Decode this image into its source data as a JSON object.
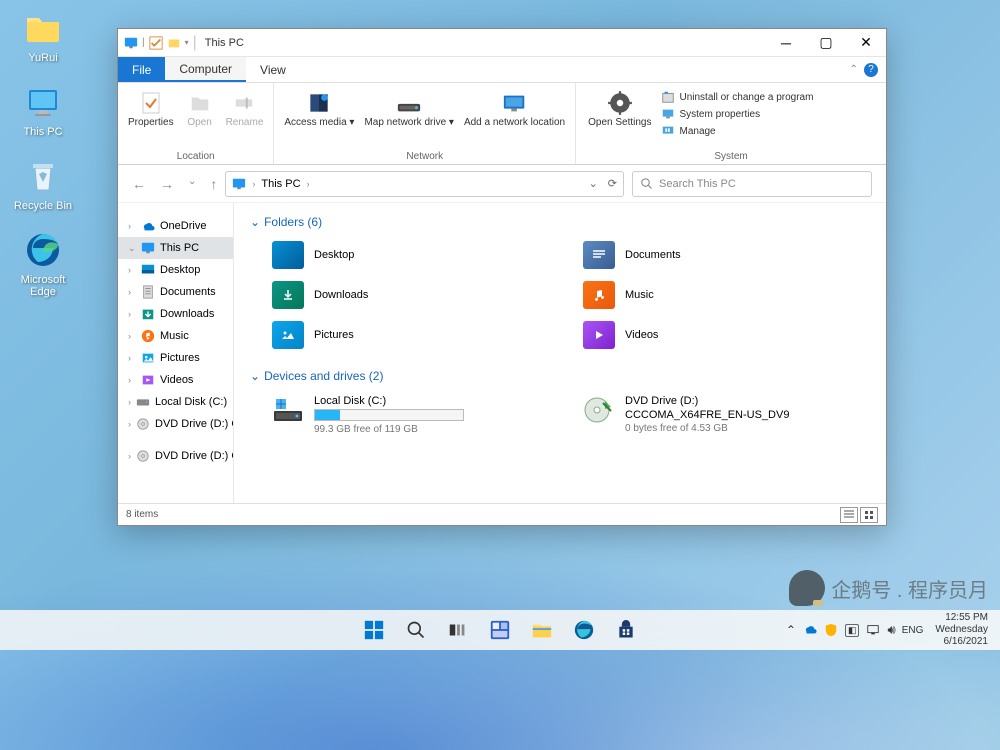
{
  "desktop_icons": [
    {
      "name": "folder-yurui",
      "label": "YuRui"
    },
    {
      "name": "this-pc-desktop",
      "label": "This PC"
    },
    {
      "name": "recycle-bin",
      "label": "Recycle Bin"
    },
    {
      "name": "edge",
      "label": "Microsoft Edge"
    }
  ],
  "titlebar": {
    "title": "This PC"
  },
  "menubar": {
    "file": "File",
    "computer": "Computer",
    "view": "View"
  },
  "ribbon": {
    "location": {
      "properties": "Properties",
      "open": "Open",
      "rename": "Rename",
      "group": "Location"
    },
    "network": {
      "access": "Access media ▾",
      "map": "Map network drive ▾",
      "add": "Add a network location",
      "group": "Network"
    },
    "system": {
      "open_settings": "Open Settings",
      "uninstall": "Uninstall or change a program",
      "properties": "System properties",
      "manage": "Manage",
      "group": "System"
    }
  },
  "address": {
    "location": "This PC"
  },
  "search": {
    "placeholder": "Search This PC"
  },
  "sidebar": [
    {
      "label": "OneDrive",
      "chev": "›",
      "icon": "cloud"
    },
    {
      "label": "This PC",
      "chev": "⌄",
      "icon": "monitor",
      "selected": true
    },
    {
      "label": "Desktop",
      "chev": "›",
      "icon": "desktop"
    },
    {
      "label": "Documents",
      "chev": "›",
      "icon": "documents"
    },
    {
      "label": "Downloads",
      "chev": "›",
      "icon": "downloads"
    },
    {
      "label": "Music",
      "chev": "›",
      "icon": "music"
    },
    {
      "label": "Pictures",
      "chev": "›",
      "icon": "pictures"
    },
    {
      "label": "Videos",
      "chev": "›",
      "icon": "videos"
    },
    {
      "label": "Local Disk (C:)",
      "chev": "›",
      "icon": "disk"
    },
    {
      "label": "DVD Drive (D:) C",
      "chev": "›",
      "icon": "dvd"
    },
    {
      "label": "DVD Drive (D:) CC",
      "chev": "›",
      "icon": "dvd",
      "gap_before": true
    }
  ],
  "content": {
    "folders_header": "Folders (6)",
    "folders": [
      {
        "label": "Desktop",
        "color1": "#0891d1",
        "color2": "#005c9c"
      },
      {
        "label": "Documents",
        "color1": "#5b8bc4",
        "color2": "#3a5d8f"
      },
      {
        "label": "Downloads",
        "color1": "#0d9488",
        "color2": "#047857"
      },
      {
        "label": "Music",
        "color1": "#f97316",
        "color2": "#ea580c"
      },
      {
        "label": "Pictures",
        "color1": "#0ea5e9",
        "color2": "#0284c7"
      },
      {
        "label": "Videos",
        "color1": "#a855f7",
        "color2": "#7e22ce"
      }
    ],
    "drives_header": "Devices and drives (2)",
    "drives": [
      {
        "name": "Local Disk (C:)",
        "sub": "99.3 GB free of 119 GB",
        "fill": 17,
        "type": "disk"
      },
      {
        "name": "DVD Drive (D:)",
        "label2": "CCCOMA_X64FRE_EN-US_DV9",
        "sub": "0 bytes free of 4.53 GB",
        "type": "dvd"
      }
    ]
  },
  "statusbar": {
    "items": "8 items"
  },
  "taskbar": {
    "tray": {
      "lang": "ENG",
      "time": "12:55 PM",
      "date1": "Wednesday",
      "date2": "6/16/2021"
    }
  }
}
